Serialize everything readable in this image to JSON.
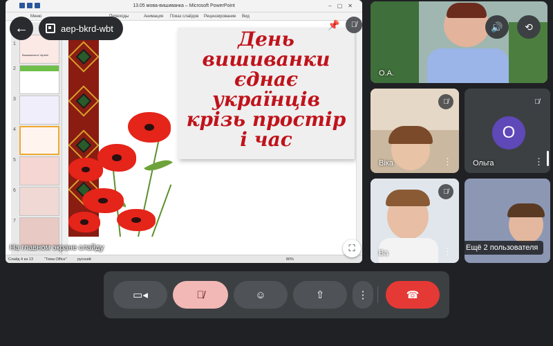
{
  "meeting": {
    "code": "aep-bkrd-wbt",
    "presenting_label": "На главном экране слайду",
    "more_users": "Ещё 2 пользователя"
  },
  "powerpoint": {
    "window_title": "13.05 мова-вишиванка – Microsoft PowerPoint",
    "tabs": [
      "Меню",
      "Переходы",
      "Анимация",
      "Показ слайдов",
      "Рецензирование",
      "Вид"
    ],
    "status_slide": "Слайд 4 из 13",
    "status_theme": "\"Тема Office\"",
    "status_lang": "русский",
    "status_zoom": "80%",
    "thumb_labels": [
      "1",
      "2",
      "3",
      "4",
      "5",
      "6",
      "7"
    ],
    "thumb1_caption": "Вишиванка в Україні",
    "slide_headline": [
      "День",
      "вишиванки",
      "єднає",
      "українців",
      "крізь простір",
      "і час"
    ]
  },
  "participants": [
    {
      "name": "О.А.",
      "muted": false
    },
    {
      "name": "Віка",
      "muted": true
    },
    {
      "name": "Ольга",
      "initial": "О",
      "muted": true
    },
    {
      "name": "Ва",
      "muted": true
    }
  ],
  "icons": {
    "back": "arrow-left-icon",
    "calendar": "calendar-icon",
    "pin": "pin-icon",
    "mic_off": "mic-off-icon",
    "volume": "volume-icon",
    "switch_camera": "switch-camera-icon",
    "fullscreen": "fullscreen-icon",
    "camera": "camera-icon",
    "emoji": "emoji-icon",
    "present": "present-screen-icon",
    "more": "more-vert-icon",
    "end_call": "end-call-icon"
  },
  "colors": {
    "mic_off_bg": "#f2b8b5",
    "end_call_bg": "#e53935",
    "headline_red": "#c0131b",
    "avatar_purple": "#5f48b8"
  }
}
